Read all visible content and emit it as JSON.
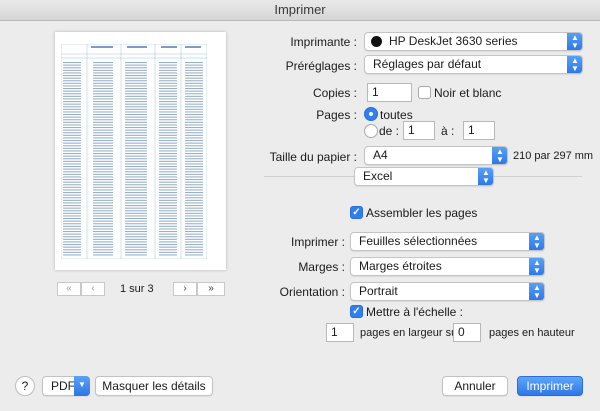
{
  "window": {
    "title": "Imprimer"
  },
  "preview": {
    "page_indicator": "1 sur 3",
    "first_symbol": "«",
    "prev_symbol": "‹",
    "next_symbol": "›",
    "last_symbol": "»"
  },
  "printer": {
    "label": "Imprimante :",
    "value": "HP DeskJet 3630 series"
  },
  "presets": {
    "label": "Préréglages :",
    "value": "Réglages par défaut"
  },
  "copies": {
    "label": "Copies :",
    "value": "1",
    "bw_label": "Noir et blanc"
  },
  "pages": {
    "label": "Pages :",
    "all_label": "toutes",
    "from_label": "de :",
    "from_value": "1",
    "to_label": "à :",
    "to_value": "1"
  },
  "paper": {
    "label": "Taille du papier :",
    "value": "A4",
    "dimensions": "210 par 297 mm"
  },
  "app_menu": {
    "value": "Excel"
  },
  "collate": {
    "label": "Assembler les pages"
  },
  "print_what": {
    "label": "Imprimer :",
    "value": "Feuilles sélectionnées"
  },
  "margins": {
    "label": "Marges :",
    "value": "Marges étroites"
  },
  "orientation": {
    "label": "Orientation :",
    "value": "Portrait"
  },
  "scale": {
    "label": "Mettre à l'échelle :",
    "wide_value": "1",
    "wide_label": "pages en largeur sur",
    "tall_value": "0",
    "tall_label": "pages en hauteur"
  },
  "footer": {
    "help": "?",
    "pdf_label": "PDF",
    "hide_details": "Masquer les détails",
    "cancel": "Annuler",
    "print": "Imprimer"
  },
  "colors": {
    "accent": "#2f7ff0",
    "background": "#ececec"
  }
}
